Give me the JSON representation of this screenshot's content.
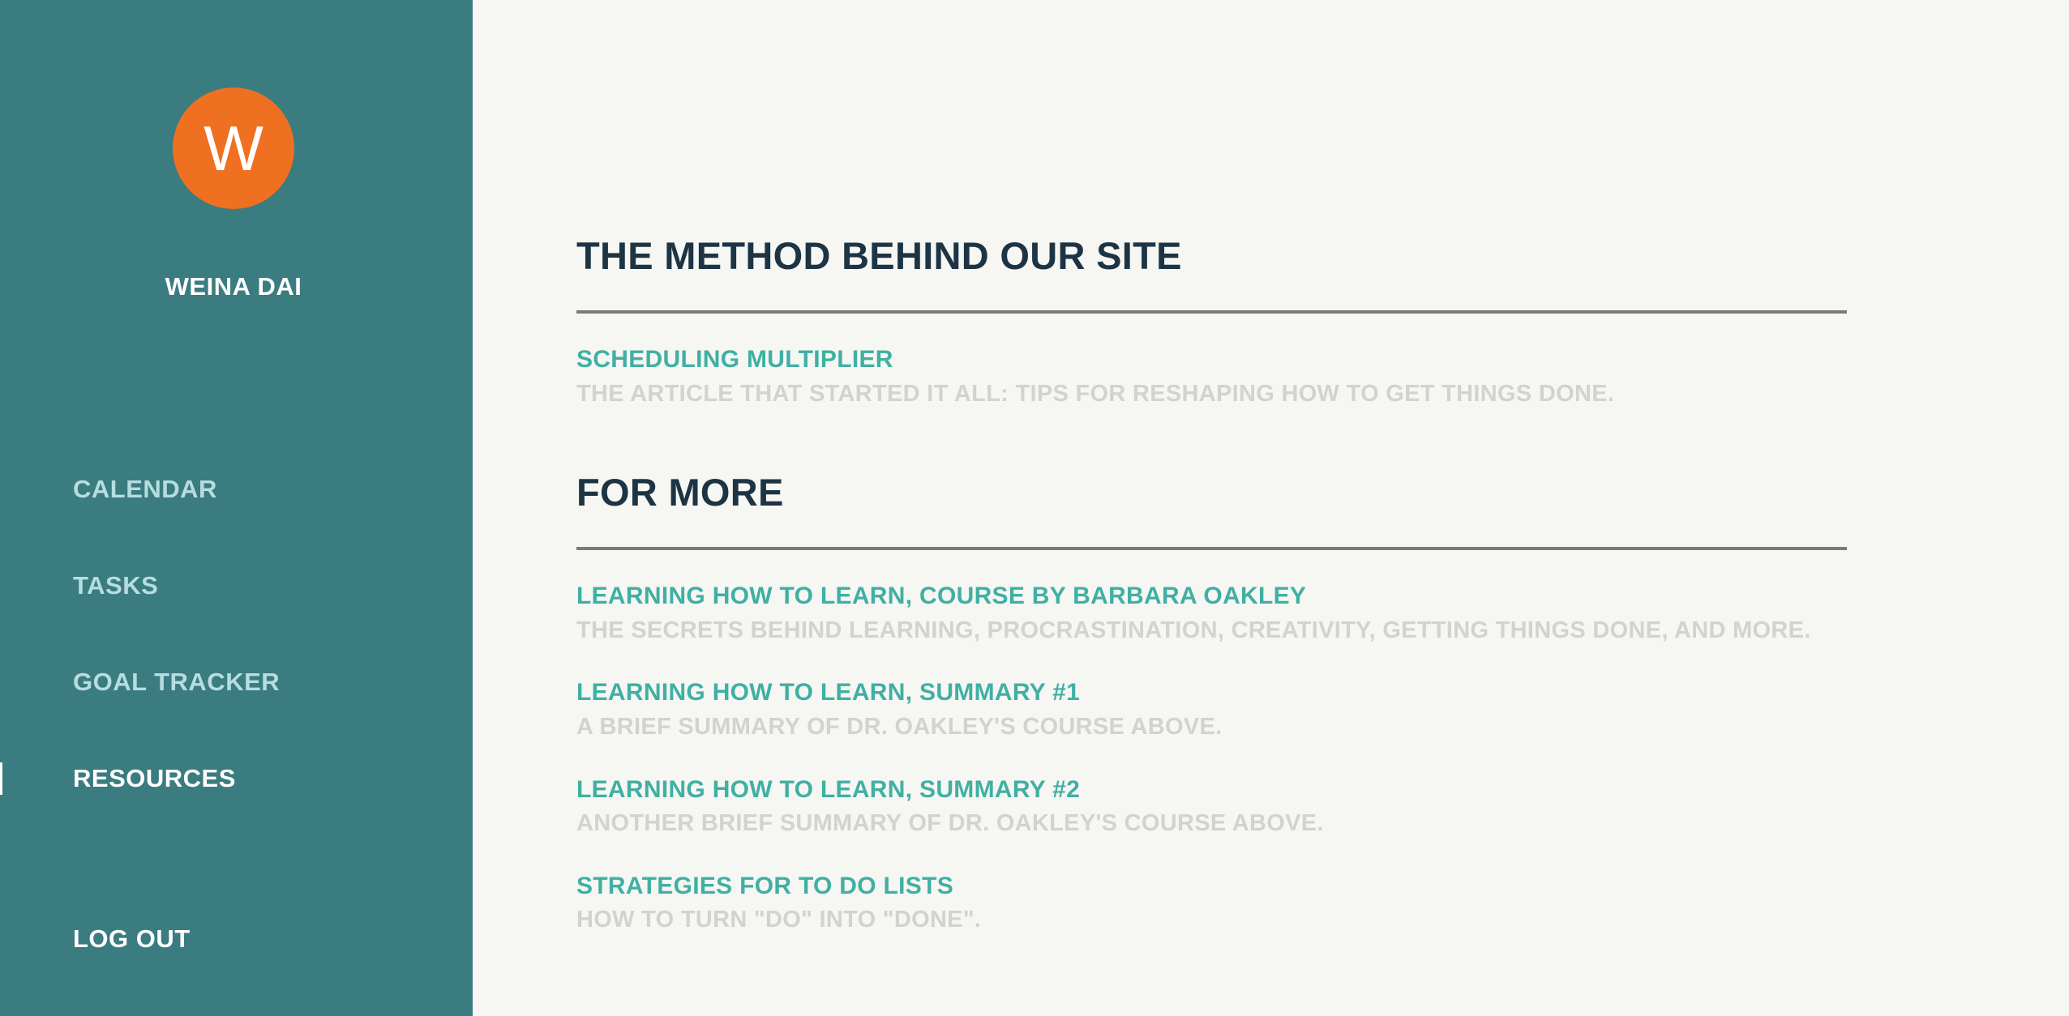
{
  "user": {
    "initial": "W",
    "name": "WEINA DAI"
  },
  "colors": {
    "sidebar": "#3a7c80",
    "avatar": "#f07021",
    "link": "#3fb0a3",
    "heading": "#1d3444",
    "description": "#d2d2d0",
    "background": "#f6f6f2"
  },
  "nav": {
    "items": [
      {
        "label": "CALENDAR",
        "active": false
      },
      {
        "label": "TASKS",
        "active": false
      },
      {
        "label": "GOAL TRACKER",
        "active": false
      },
      {
        "label": "RESOURCES",
        "active": true
      }
    ],
    "logout": "LOG OUT"
  },
  "sections": [
    {
      "title": "THE METHOD BEHIND OUR SITE",
      "resources": [
        {
          "title": "SCHEDULING MULTIPLIER",
          "description": "THE ARTICLE THAT STARTED IT ALL: TIPS FOR RESHAPING HOW TO GET THINGS DONE."
        }
      ]
    },
    {
      "title": "FOR MORE",
      "resources": [
        {
          "title": "LEARNING HOW TO LEARN, COURSE BY BARBARA OAKLEY",
          "description": "THE SECRETS BEHIND LEARNING, PROCRASTINATION, CREATIVITY, GETTING THINGS DONE, AND MORE."
        },
        {
          "title": "LEARNING HOW TO LEARN, SUMMARY #1",
          "description": "A BRIEF SUMMARY OF DR. OAKLEY'S COURSE ABOVE."
        },
        {
          "title": "LEARNING HOW TO LEARN, SUMMARY #2",
          "description": "ANOTHER BRIEF SUMMARY OF DR. OAKLEY'S COURSE ABOVE."
        },
        {
          "title": "STRATEGIES FOR TO DO LISTS",
          "description": "HOW TO TURN \"DO\" INTO \"DONE\"."
        }
      ]
    }
  ]
}
